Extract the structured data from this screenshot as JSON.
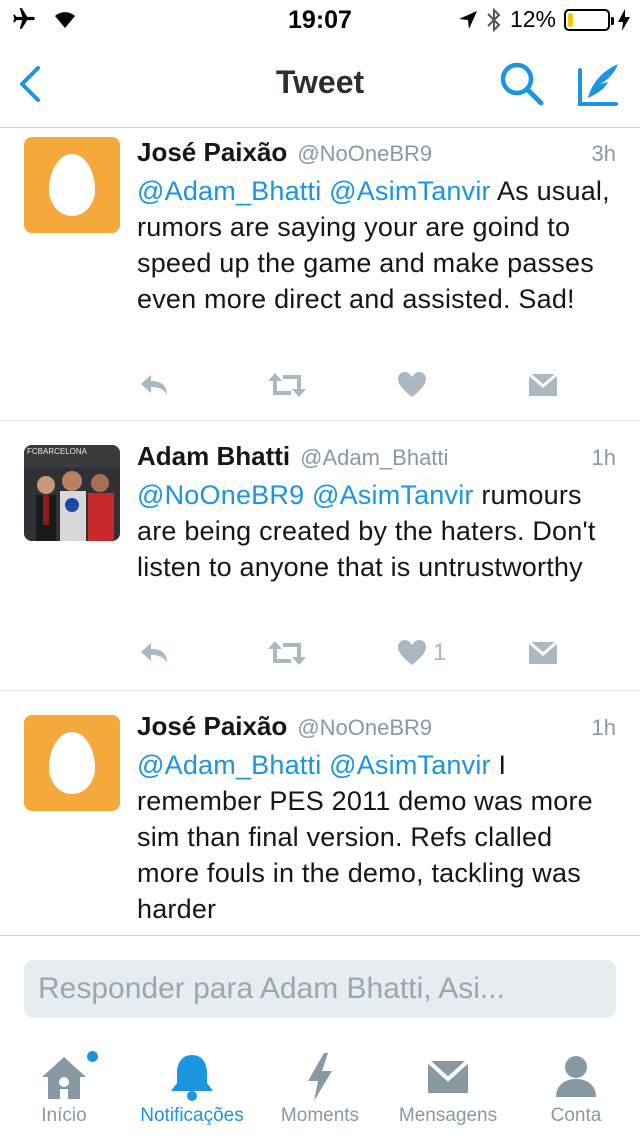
{
  "status_bar": {
    "time": "19:07",
    "battery_text": "12%",
    "battery_level": 0.12
  },
  "nav": {
    "title": "Tweet",
    "icons": [
      "back-chevron-icon",
      "search-icon",
      "compose-icon"
    ]
  },
  "tweets": [
    {
      "name": "José Paixão",
      "handle": "@NoOneBR9",
      "time": "3h",
      "mentions": [
        "@Adam_Bhatti",
        "@AsimTanvir"
      ],
      "text": "As usual, rumors are saying your are goind to speed up the game and make passes even more direct and assisted. Sad!",
      "like_count": ""
    },
    {
      "name": "Adam Bhatti",
      "handle": "@Adam_Bhatti",
      "time": "1h",
      "mentions": [
        "@NoOneBR9",
        "@AsimTanvir"
      ],
      "text": "rumours are being created by the haters. Don't listen to anyone that is untrustworthy",
      "like_count": "1",
      "avatar_text": "FCBARCELONA"
    },
    {
      "name": "José Paixão",
      "handle": "@NoOneBR9",
      "time": "1h",
      "mentions": [
        "@Adam_Bhatti",
        "@AsimTanvir"
      ],
      "text": "I remember PES 2011 demo was more sim than final version. Refs clalled more fouls in the demo, tackling was harder",
      "like_count": ""
    }
  ],
  "reply": {
    "placeholder": "Responder para Adam Bhatti, Asi..."
  },
  "tabs": [
    {
      "label": "Início",
      "icon": "home-icon",
      "active": false,
      "badge": true
    },
    {
      "label": "Notificações",
      "icon": "bell-icon",
      "active": true,
      "badge": false
    },
    {
      "label": "Moments",
      "icon": "lightning-icon",
      "active": false,
      "badge": false
    },
    {
      "label": "Mensagens",
      "icon": "envelope-icon",
      "active": false,
      "badge": false
    },
    {
      "label": "Conta",
      "icon": "person-icon",
      "active": false,
      "badge": false
    }
  ],
  "colors": {
    "accent": "#1b95e0",
    "egg_avatar": "#f5a93a",
    "action_gray": "#aab8c2",
    "battery_yellow": "#f5c518"
  }
}
